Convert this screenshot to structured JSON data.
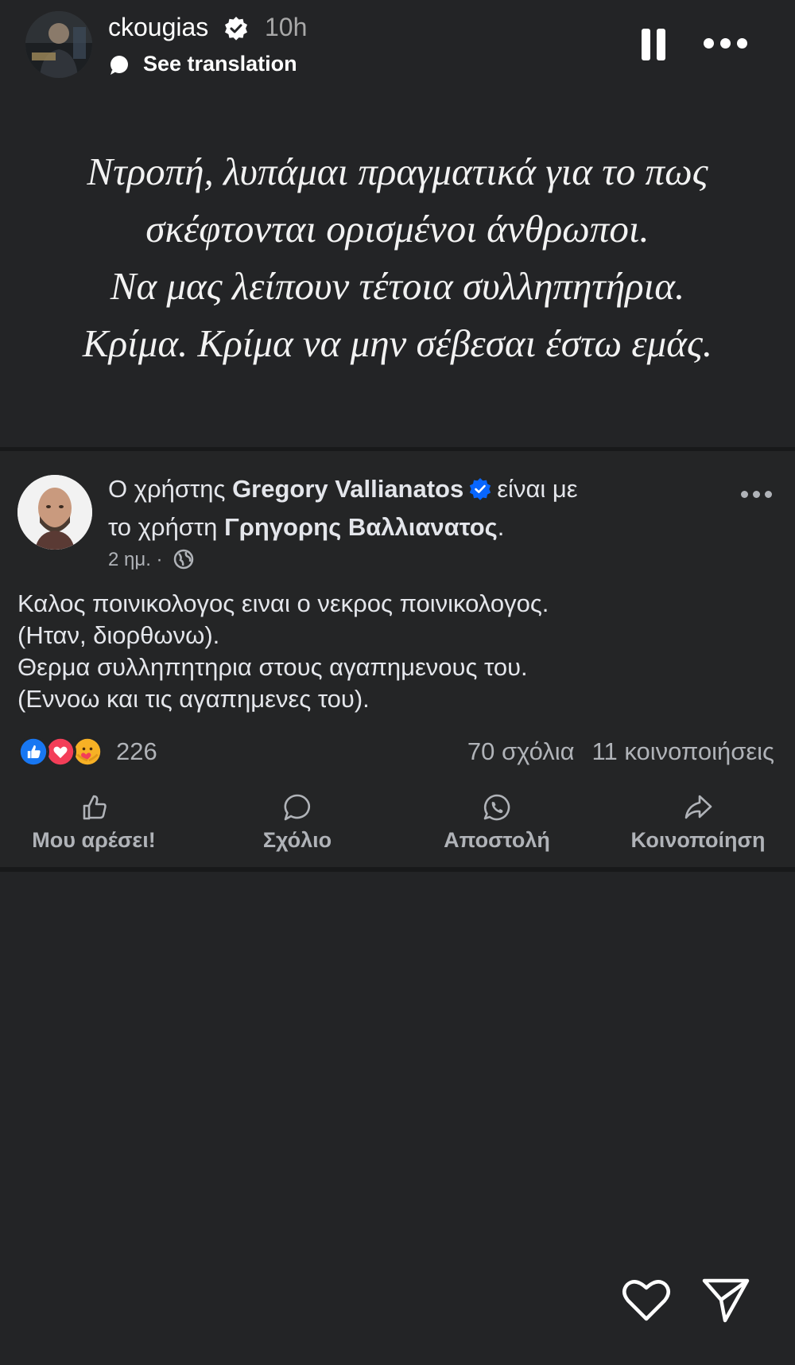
{
  "story": {
    "username": "ckougias",
    "time": "10h",
    "see_translation": "See translation",
    "icons": {
      "verified": "verified-badge-icon",
      "translate": "translate-bubble-icon",
      "pause": "pause-icon",
      "more": "more-horizontal-icon",
      "like": "heart-icon",
      "share": "send-icon"
    }
  },
  "quote": {
    "lines": [
      "Ντροπή, λυπάμαι πραγματικά για το πως",
      "σκέφτονται ορισμένοι άνθρωποι.",
      "Να μας λείπουν τέτοια συλληπητήρια.",
      "Κρίμα. Κρίμα να μην σέβεσαι έστω εμάς."
    ]
  },
  "fb_post": {
    "header_prefix": "Ο χρήστης",
    "author": "Gregory Vallianatos",
    "header_middle": "είναι με",
    "header_with_prefix": "το χρήστη",
    "tagged": "Γρηγορης Βαλλιανατος",
    "header_suffix": ".",
    "time": "2 ημ.",
    "separator": "·",
    "body_lines": [
      "Καλος ποινικολογος ειναι ο νεκρος ποινικολογος.",
      "(Ηταν, διορθωνω).",
      "Θερμα συλληπητηρια στους αγαπημενους του.",
      "(Εννοω και τις αγαπημενες του)."
    ],
    "reactions_count": "226",
    "comments": "70 σχόλια",
    "shares": "11 κοινοποιήσεις",
    "actions": {
      "like": "Μου αρέσει!",
      "comment": "Σχόλιο",
      "send": "Αποστολή",
      "share": "Κοινοποίηση"
    },
    "colors": {
      "like_blue": "#1877f2",
      "love_red": "#f33e58",
      "care_yellow": "#f7b125",
      "verified_blue": "#0866ff"
    }
  }
}
